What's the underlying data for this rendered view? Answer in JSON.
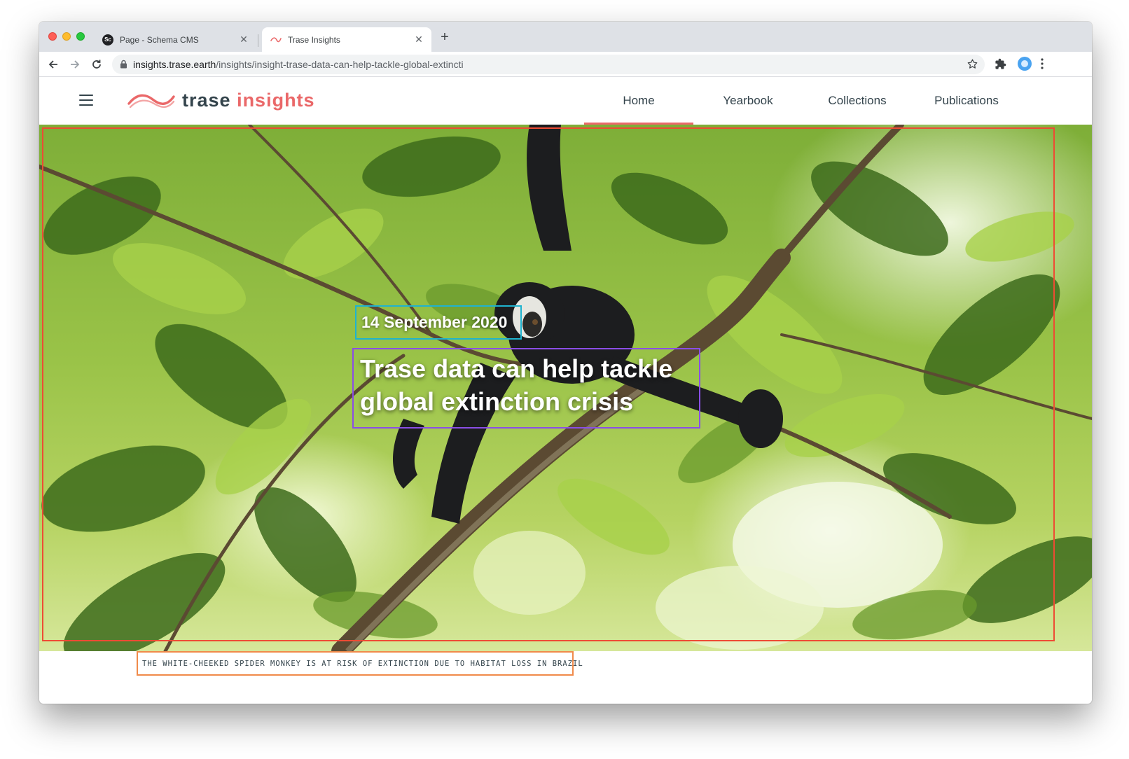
{
  "browser": {
    "tabs": [
      {
        "title": "Page - Schema CMS",
        "favicon": "Sc",
        "active": false
      },
      {
        "title": "Trase Insights",
        "active": true
      }
    ],
    "url_host": "insights.trase.earth",
    "url_path": "/insights/insight-trase-data-can-help-tackle-global-extincti"
  },
  "site": {
    "logo_word1": "trase",
    "logo_word2": "insights",
    "brand_color": "#ea6869",
    "text_color": "#34444c",
    "nav": [
      {
        "label": "Home",
        "active": true
      },
      {
        "label": "Yearbook",
        "active": false
      },
      {
        "label": "Collections",
        "active": false
      },
      {
        "label": "Publications",
        "active": false
      }
    ]
  },
  "hero": {
    "date": "14 September 2020",
    "title": "Trase data can help tackle global extinction crisis",
    "caption": "THE WHITE-CHEEKED SPIDER MONKEY IS AT RISK OF EXTINCTION DUE TO HABITAT LOSS IN BRAZIL"
  },
  "icons": {
    "back": "arrow-left-icon",
    "forward": "arrow-right-icon",
    "reload": "reload-icon",
    "lock": "lock-icon",
    "bookmark": "star-icon",
    "extensions": "puzzle-icon",
    "profile": "profile-icon",
    "menu": "kebab-menu-icon",
    "hamburger": "hamburger-icon"
  }
}
